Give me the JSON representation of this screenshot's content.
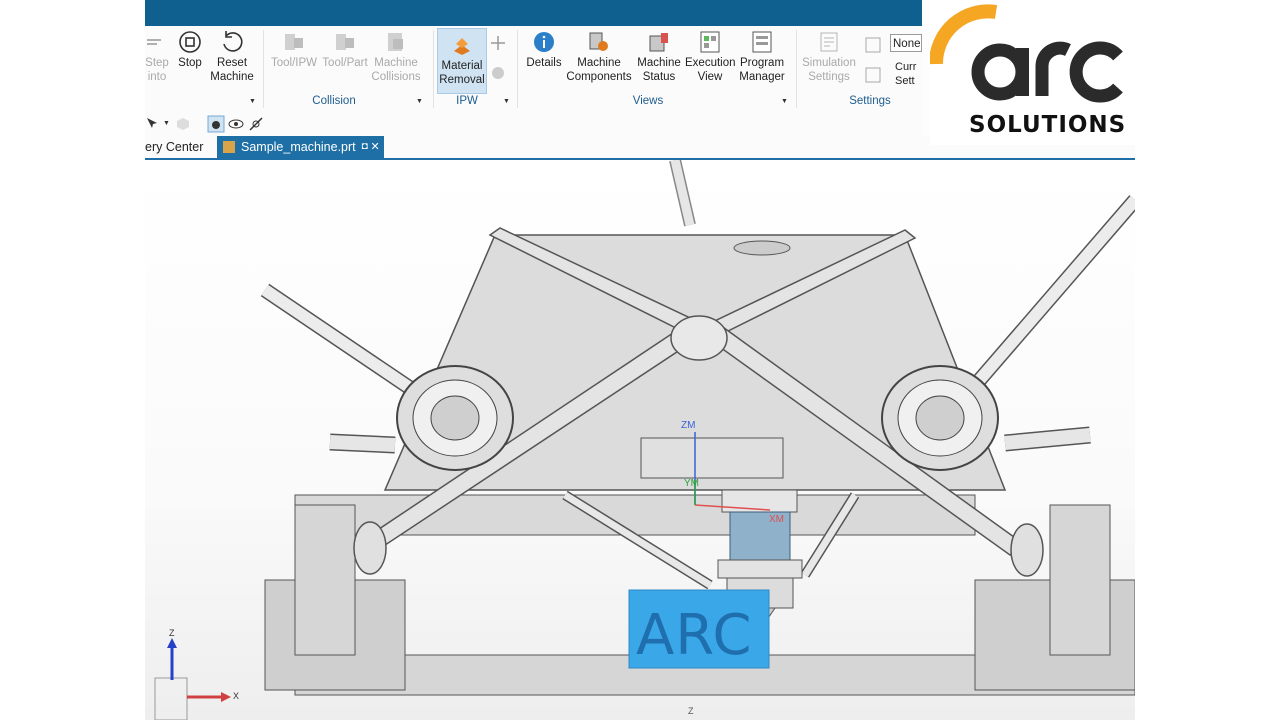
{
  "ribbon": {
    "step_into": "Step\ninto",
    "stop": "Stop",
    "reset_machine": "Reset\nMachine",
    "tool_ipw": "Tool/IPW",
    "tool_part": "Tool/Part",
    "machine_collisions": "Machine\nCollisions",
    "material_removal": "Material\nRemoval",
    "details": "Details",
    "machine_components": "Machine\nComponents",
    "machine_status": "Machine\nStatus",
    "execution_view": "Execution\nView",
    "program_manager": "Program\nManager",
    "simulation_settings": "Simulation\nSettings",
    "current_settings": "Curr\nSett",
    "none_value": "None",
    "groups": {
      "collision": "Collision",
      "ipw": "IPW",
      "views": "Views",
      "settings": "Settings"
    }
  },
  "tabs": [
    {
      "label": "ery Center"
    },
    {
      "label": "Sample_machine.prt",
      "active": true
    }
  ],
  "viewport": {
    "wcs": {
      "zm": "ZM",
      "ym": "YM",
      "xm": "XM"
    },
    "triad": {
      "z": "Z",
      "x": "X"
    },
    "part_text": "ARC",
    "bottom_label": "Z"
  },
  "logo": {
    "mark": "arc",
    "text": "SOLUTIONS"
  },
  "colors": {
    "titlebar": "#0f5f8f",
    "tab_active": "#1d6fa5",
    "logo_accent": "#f5a623",
    "workpiece": "#3aa8e8"
  }
}
